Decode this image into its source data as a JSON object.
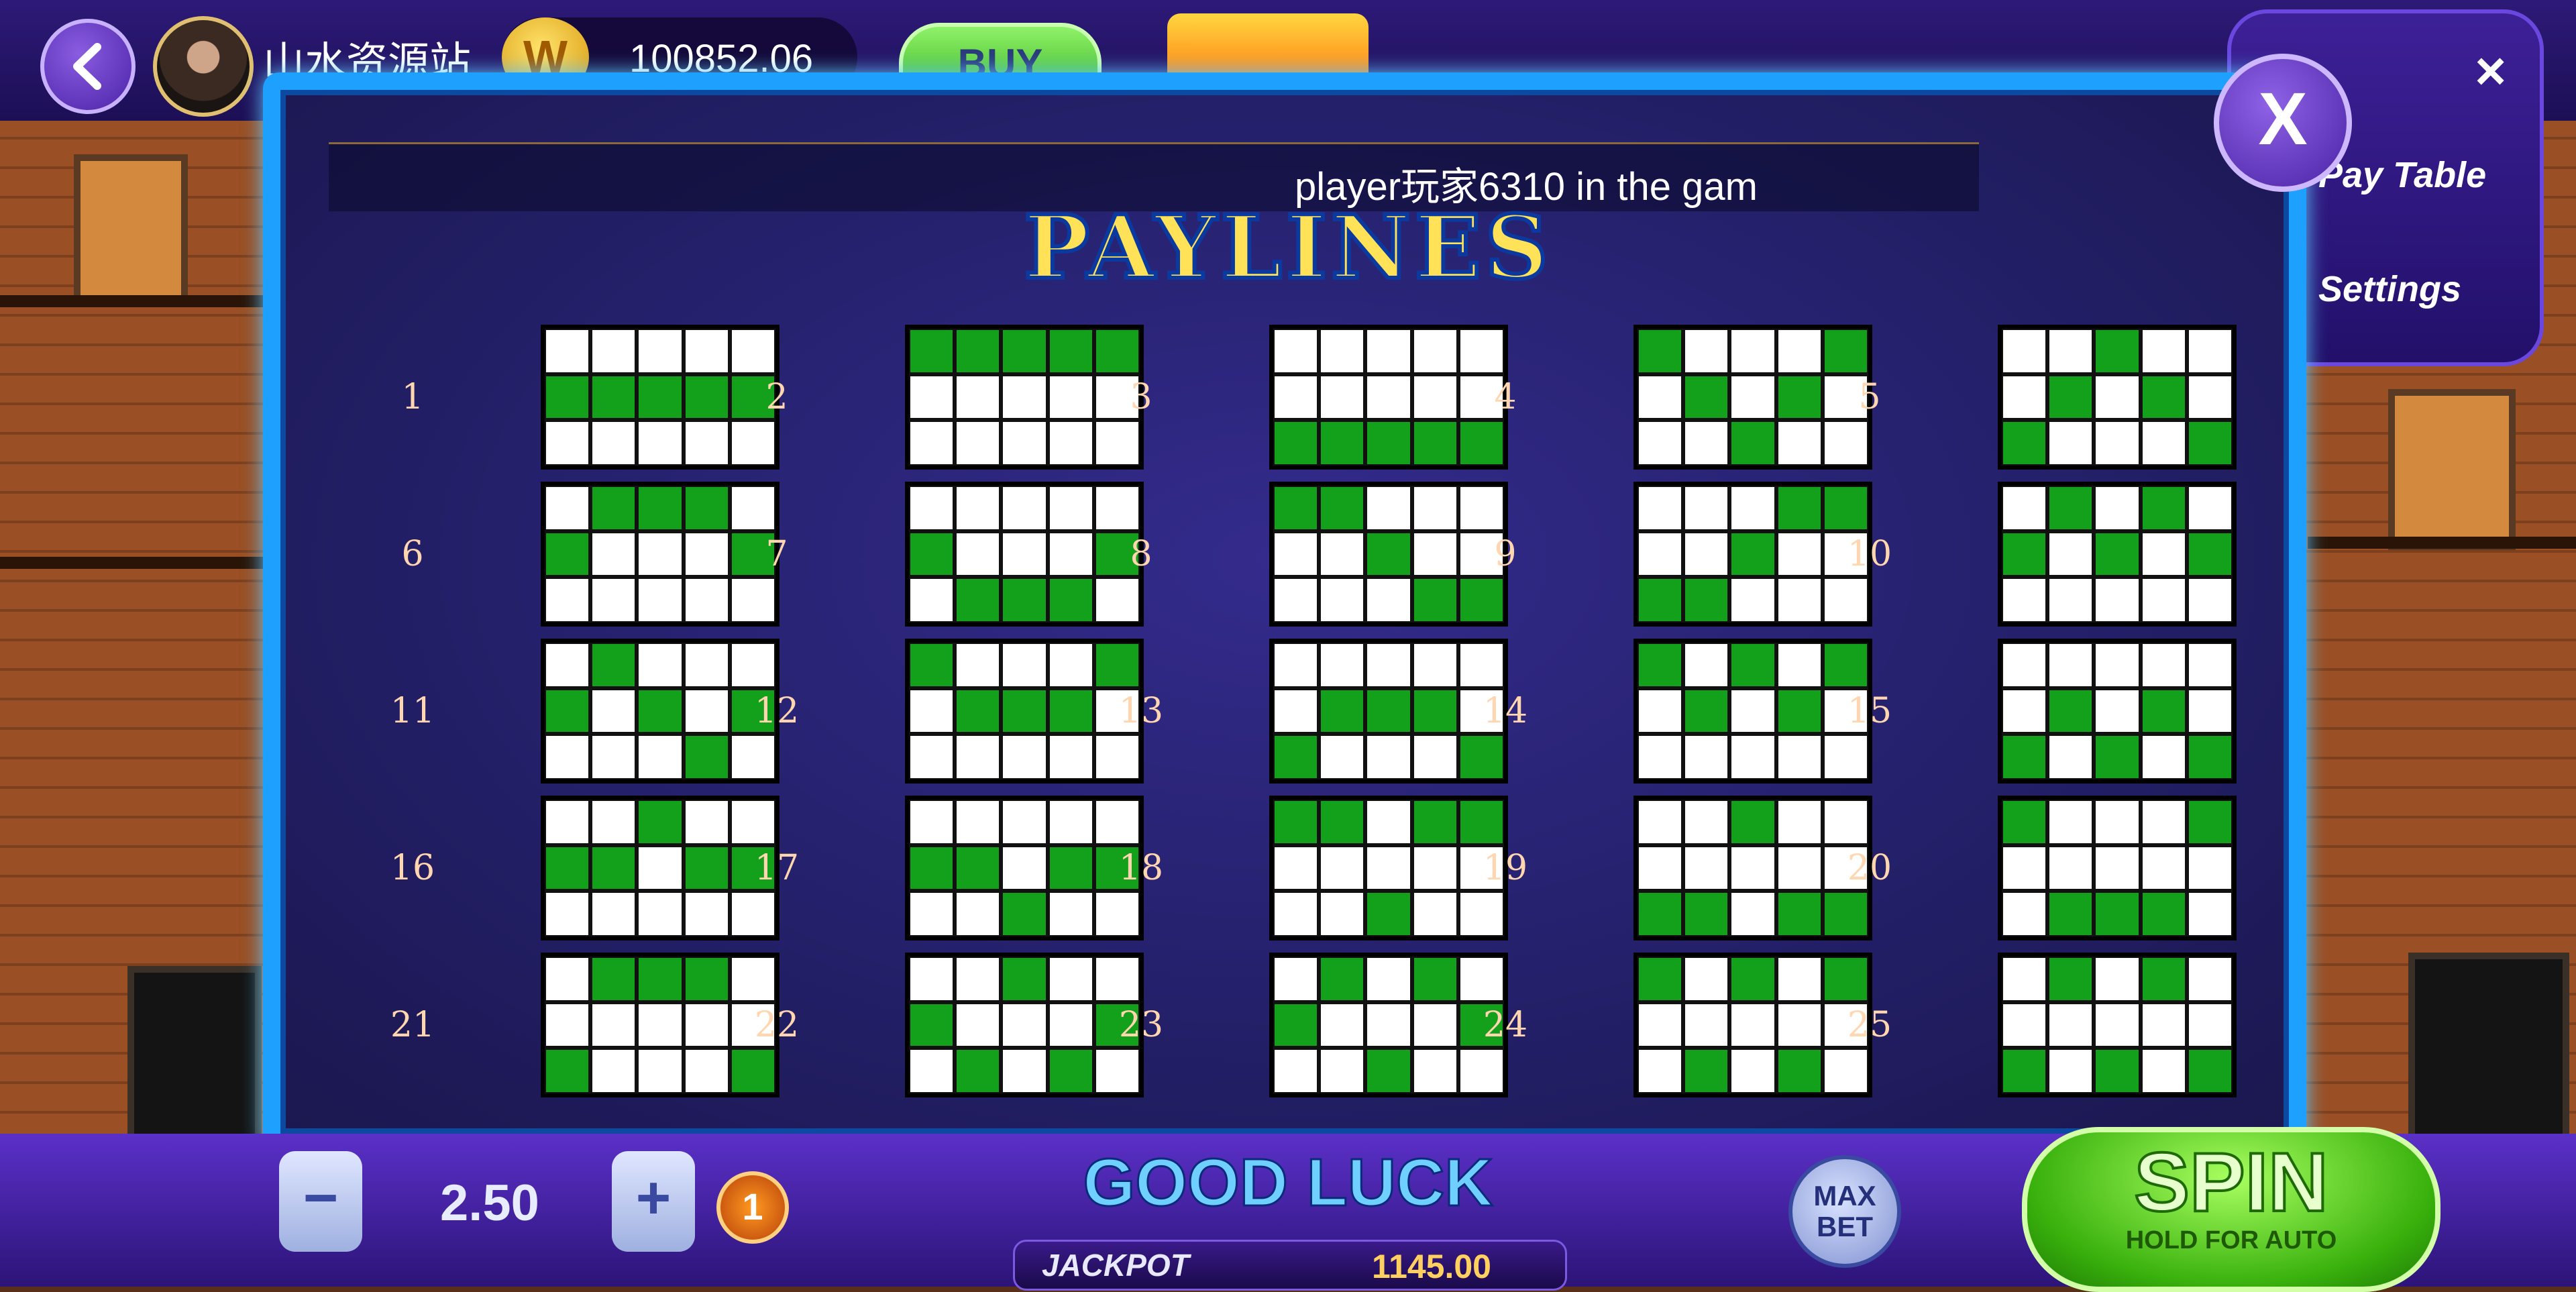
{
  "topbar": {
    "username": "山水资源站",
    "coin_symbol": "W",
    "balance": "100852.06",
    "buy_label": "BUY"
  },
  "sidemenu": {
    "close_glyph": "×",
    "items": [
      "Pay Table",
      "Settings"
    ]
  },
  "panel": {
    "ticker": "player玩家6310 in the gam",
    "title": "PAYLINES",
    "close_label": "X"
  },
  "paylines": [
    {
      "n": "1",
      "rows": [
        "00000",
        "11111",
        "00000"
      ]
    },
    {
      "n": "2",
      "rows": [
        "11111",
        "00000",
        "00000"
      ]
    },
    {
      "n": "3",
      "rows": [
        "00000",
        "00000",
        "11111"
      ]
    },
    {
      "n": "4",
      "rows": [
        "10001",
        "01010",
        "00100"
      ]
    },
    {
      "n": "5",
      "rows": [
        "00100",
        "01010",
        "10001"
      ]
    },
    {
      "n": "6",
      "rows": [
        "01110",
        "10001",
        "00000"
      ]
    },
    {
      "n": "7",
      "rows": [
        "00000",
        "10001",
        "01110"
      ]
    },
    {
      "n": "8",
      "rows": [
        "11000",
        "00100",
        "00011"
      ]
    },
    {
      "n": "9",
      "rows": [
        "00011",
        "00100",
        "11000"
      ]
    },
    {
      "n": "10",
      "rows": [
        "01010",
        "10101",
        "00000"
      ]
    },
    {
      "n": "11",
      "rows": [
        "01000",
        "10101",
        "00010"
      ]
    },
    {
      "n": "12",
      "rows": [
        "10001",
        "01110",
        "00000"
      ]
    },
    {
      "n": "13",
      "rows": [
        "00000",
        "01110",
        "10001"
      ]
    },
    {
      "n": "14",
      "rows": [
        "10101",
        "01010",
        "00000"
      ]
    },
    {
      "n": "15",
      "rows": [
        "00000",
        "01010",
        "10101"
      ]
    },
    {
      "n": "16",
      "rows": [
        "00100",
        "11011",
        "00000"
      ]
    },
    {
      "n": "17",
      "rows": [
        "00000",
        "11011",
        "00100"
      ]
    },
    {
      "n": "18",
      "rows": [
        "11011",
        "00000",
        "00100"
      ]
    },
    {
      "n": "19",
      "rows": [
        "00100",
        "00000",
        "11011"
      ]
    },
    {
      "n": "20",
      "rows": [
        "10001",
        "00000",
        "01110"
      ]
    },
    {
      "n": "21",
      "rows": [
        "01110",
        "00000",
        "10001"
      ]
    },
    {
      "n": "22",
      "rows": [
        "00100",
        "10001",
        "01010"
      ]
    },
    {
      "n": "23",
      "rows": [
        "01010",
        "10001",
        "00100"
      ]
    },
    {
      "n": "24",
      "rows": [
        "10101",
        "00000",
        "01010"
      ]
    },
    {
      "n": "25",
      "rows": [
        "01010",
        "00000",
        "10101"
      ]
    }
  ],
  "bottombar": {
    "minus": "−",
    "plus": "+",
    "bet": "2.50",
    "lines_badge": "1",
    "good_luck": "GOOD LUCK",
    "jackpot_label": "JACKPOT",
    "jackpot_value": "1145.00",
    "maxbet_line1": "MAX",
    "maxbet_line2": "BET",
    "spin_label": "SPIN",
    "spin_sub": "HOLD FOR AUTO"
  },
  "colors": {
    "payline_on": "#13a01a",
    "payline_off": "#ffffff",
    "panel_border": "#1ea0ff",
    "title": "#ffe257"
  }
}
